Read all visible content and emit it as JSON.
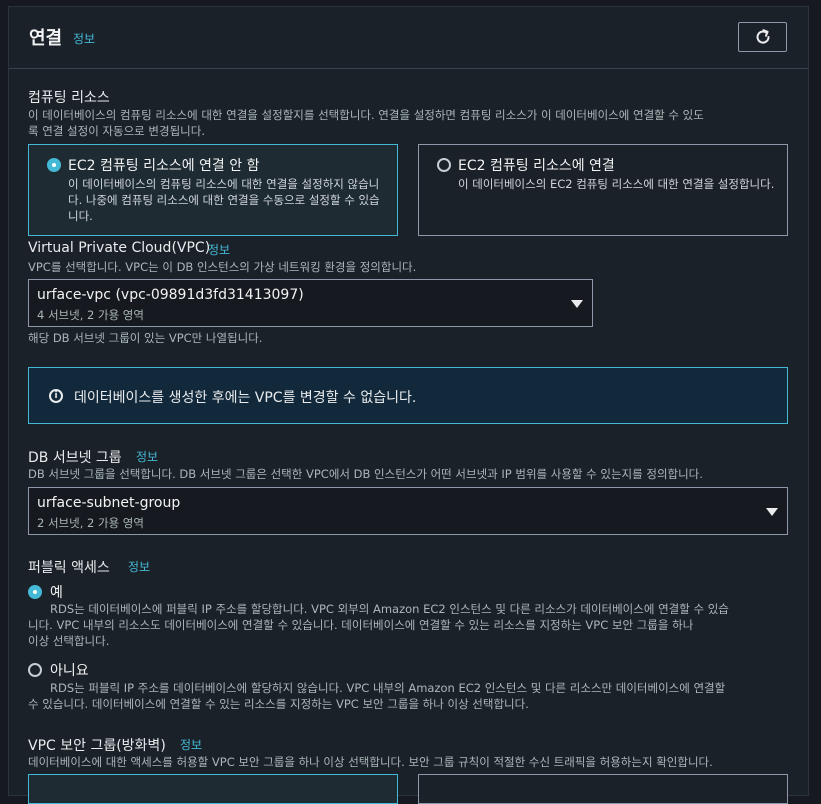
{
  "header": {
    "title": "연결",
    "info": "정보"
  },
  "compute": {
    "label": "컴퓨팅 리소스",
    "desc1": "이 데이터베이스의 컴퓨팅 리소스에 대한 연결을 설정할지를 선택합니다. 연결을 설정하면 컴퓨팅 리소스가 이 데이터베이스에 연결할 수 있도",
    "desc2": "록 연결 설정이 자동으로 변경됩니다.",
    "options": [
      {
        "title": "EC2 컴퓨팅 리소스에 연결 안 함",
        "desc": "이 데이터베이스의 컴퓨팅 리소스에 대한 연결을 설정하지 않습니다. 나중에 컴퓨팅 리소스에 대한 연결을 수동으로 설정할 수 있습니다.",
        "selected": true
      },
      {
        "title": "EC2 컴퓨팅 리소스에 연결",
        "desc": "이 데이터베이스의 EC2 컴퓨팅 리소스에 대한 연결을 설정합니다.",
        "selected": false
      }
    ]
  },
  "vpc": {
    "label": "Virtual Private Cloud(VPC)",
    "info": "정보",
    "desc": "VPC를 선택합니다. VPC는 이 DB 인스턴스의 가상 네트워킹 환경을 정의합니다.",
    "value": "urface-vpc (vpc-09891d3fd31413097)",
    "sub": "4 서브넷, 2 가용 영역",
    "hint": "해당 DB 서브넷 그룹이 있는 VPC만 나열됩니다."
  },
  "alert": {
    "text": "데이터베이스를 생성한 후에는 VPC를 변경할 수 없습니다."
  },
  "subnet": {
    "label": "DB 서브넷 그룹",
    "info": "정보",
    "desc": "DB 서브넷 그룹을 선택합니다. DB 서브넷 그룹은 선택한 VPC에서 DB 인스턴스가 어떤 서브넷과 IP 범위를 사용할 수 있는지를 정의합니다.",
    "value": "urface-subnet-group",
    "sub": "2 서브넷, 2 가용 영역"
  },
  "public": {
    "label": "퍼블릭 액세스",
    "info": "정보",
    "yes": {
      "label": "예",
      "desc1": "RDS는 데이터베이스에 퍼블릭 IP 주소를 할당합니다. VPC 외부의 Amazon EC2 인스턴스 및 다른 리소스가 데이터베이스에 연결할 수 있습",
      "desc2": "니다. VPC 내부의 리소스도 데이터베이스에 연결할 수 있습니다. 데이터베이스에 연결할 수 있는 리소스를 지정하는 VPC 보안 그룹을 하나",
      "desc3": "이상 선택합니다.",
      "selected": true
    },
    "no": {
      "label": "아니요",
      "desc1": "RDS는 퍼블릭 IP 주소를 데이터베이스에 할당하지 않습니다. VPC 내부의 Amazon EC2 인스턴스 및 다른 리소스만 데이터베이스에 연결할",
      "desc2": "수 있습니다. 데이터베이스에 연결할 수 있는 리소스를 지정하는 VPC 보안 그룹을 하나 이상 선택합니다.",
      "selected": false
    }
  },
  "sg": {
    "label": "VPC 보안 그룹(방화벽)",
    "info": "정보",
    "desc": "데이터베이스에 대한 액세스를 허용할 VPC 보안 그룹을 하나 이상 선택합니다. 보안 그룹 규칙이 적절한 수신 트래픽을 허용하는지 확인합니다."
  },
  "colors": {
    "accent": "#44b9d6",
    "panel": "#1b2129",
    "alert_bg": "#12293b"
  }
}
